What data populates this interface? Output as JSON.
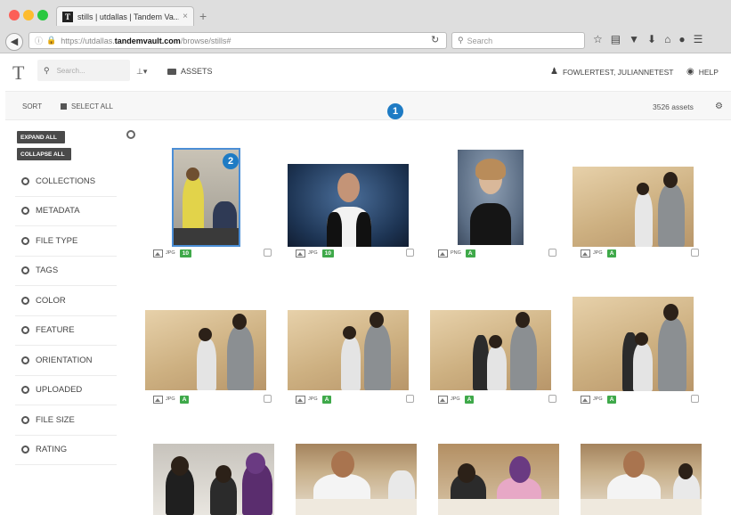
{
  "browser": {
    "tab_title": "stills | utdallas | Tandem Va...",
    "tab_close": "×",
    "new_tab": "+",
    "url_prefix": "https://utdallas.",
    "url_host": "tandemvault.com",
    "url_path": "/browse/stills#",
    "search_placeholder": "Search",
    "toolbar_icons": [
      "star-icon",
      "reading-list-icon",
      "pocket-icon",
      "download-icon",
      "home-icon",
      "chat-icon",
      "menu-icon"
    ]
  },
  "app": {
    "logo": "T",
    "search_placeholder": "Search...",
    "sitemap_label": "⊥▾",
    "assets_label": "ASSETS",
    "user_label": "FOWLERTEST, JULIANNETEST",
    "help_label": "HELP"
  },
  "subheader": {
    "sort_label": "SORT",
    "select_all_label": "SELECT ALL",
    "asset_count": "3526 assets"
  },
  "callouts": {
    "one": "1",
    "two": "2"
  },
  "sidebar": {
    "expand_all": "EXPAND ALL",
    "collapse_all": "COLLAPSE ALL",
    "facets": [
      "COLLECTIONS",
      "METADATA",
      "FILE TYPE",
      "TAGS",
      "COLOR",
      "FEATURE",
      "ORIENTATION",
      "UPLOADED",
      "FILE SIZE",
      "RATING"
    ]
  },
  "assets": [
    {
      "type": "JPG",
      "rating": "10",
      "selected": true
    },
    {
      "type": "JPG",
      "rating": "10",
      "selected": false
    },
    {
      "type": "PNG",
      "rating": "A",
      "selected": false
    },
    {
      "type": "JPG",
      "rating": "A",
      "selected": false
    },
    {
      "type": "JPG",
      "rating": "A",
      "selected": false
    },
    {
      "type": "JPG",
      "rating": "A",
      "selected": false
    },
    {
      "type": "JPG",
      "rating": "A",
      "selected": false
    },
    {
      "type": "JPG",
      "rating": "A",
      "selected": false
    }
  ],
  "colors": {
    "badge": "#3fa94a",
    "callout": "#1e7bc4",
    "selection": "#4b8ed6"
  }
}
